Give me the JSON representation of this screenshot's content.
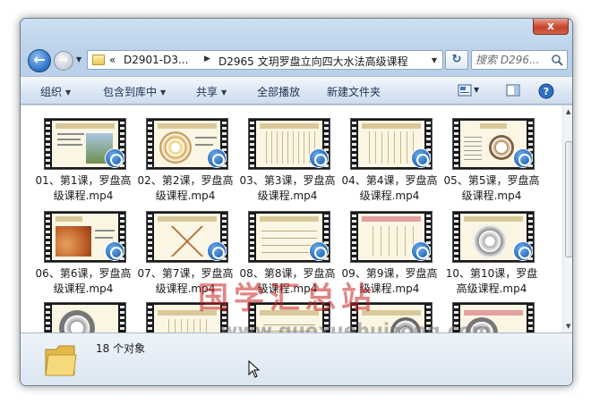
{
  "window": {
    "close_glyph": "x"
  },
  "address": {
    "chevron": "«",
    "crumbs": [
      "D2901-D3...",
      "D2965 文玥罗盘立向四大水法高级课程"
    ],
    "search_placeholder": "搜索 D296..."
  },
  "toolbar": {
    "organize": "组织",
    "include_library": "包含到库中",
    "share": "共享",
    "play_all": "全部播放",
    "new_folder": "新建文件夹"
  },
  "files": [
    {
      "label": "01、第1课，罗盘高级课程.mp4"
    },
    {
      "label": "02、第2课，罗盘高级课程.mp4"
    },
    {
      "label": "03、第3课，罗盘高级课程.mp4"
    },
    {
      "label": "04、第4课，罗盘高级课程.mp4"
    },
    {
      "label": "05、第5课，罗盘高级课程.mp4"
    },
    {
      "label": "06、第6课，罗盘高级课程.mp4"
    },
    {
      "label": "07、第7课，罗盘高级课程.mp4"
    },
    {
      "label": "08、第8课，罗盘高级课程.mp4"
    },
    {
      "label": "09、第9课，罗盘高级课程.mp4"
    },
    {
      "label": "10、第10课，罗盘高级课程.mp4"
    },
    {
      "label": ""
    },
    {
      "label": ""
    },
    {
      "label": ""
    },
    {
      "label": ""
    },
    {
      "label": ""
    }
  ],
  "watermark": {
    "text": "国学汇总站",
    "url": "www.guoxuehuizong.com"
  },
  "details": {
    "count": "18 个对象"
  }
}
